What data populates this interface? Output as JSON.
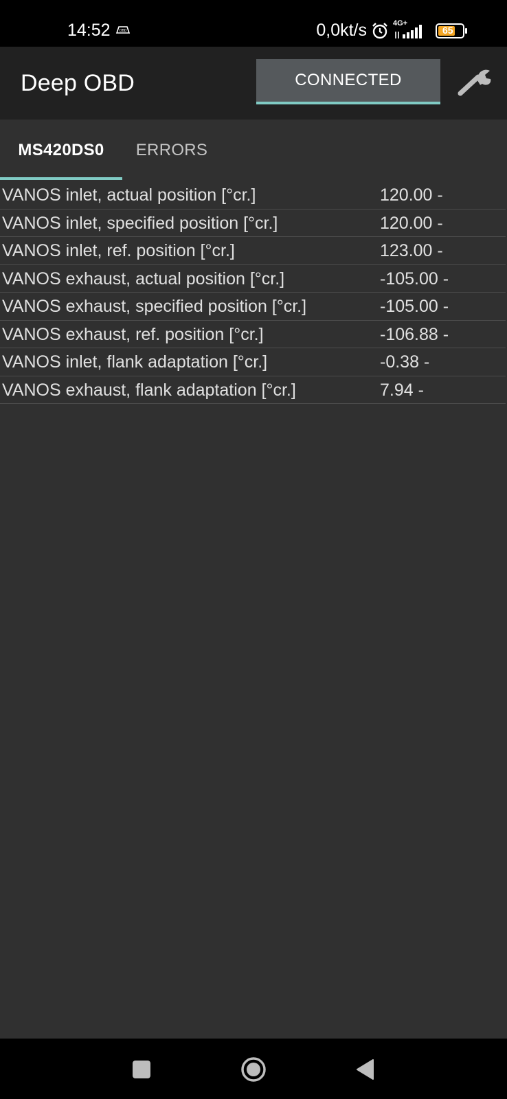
{
  "status_bar": {
    "time": "14:52",
    "obd_badge": "OBD",
    "network_speed": "0,0kt/s",
    "network_type": "4G+",
    "battery_level": "65",
    "icons": [
      "alarm-icon",
      "signal-icon",
      "battery-icon"
    ]
  },
  "app_bar": {
    "title": "Deep OBD",
    "connect_button": "CONNECTED",
    "settings_icon": "wrench-icon"
  },
  "tabs": [
    {
      "label": "MS420DS0",
      "selected": true
    },
    {
      "label": "ERRORS",
      "selected": false
    }
  ],
  "rows": [
    {
      "label": "VANOS inlet, actual position [°cr.]",
      "value": "120.00 -"
    },
    {
      "label": "VANOS inlet, specified position [°cr.]",
      "value": "120.00 -"
    },
    {
      "label": "VANOS inlet, ref. position [°cr.]",
      "value": "123.00 -"
    },
    {
      "label": "VANOS exhaust, actual position [°cr.]",
      "value": "-105.00 -"
    },
    {
      "label": "VANOS exhaust, specified position [°cr.]",
      "value": "-105.00 -"
    },
    {
      "label": "VANOS exhaust, ref. position [°cr.]",
      "value": "-106.88 -"
    },
    {
      "label": "VANOS inlet, flank adaptation [°cr.]",
      "value": "-0.38 -"
    },
    {
      "label": "VANOS exhaust, flank adaptation [°cr.]",
      "value": "7.94 -"
    }
  ],
  "nav_bar": {
    "icons": [
      "recents-icon",
      "home-icon",
      "back-icon"
    ]
  },
  "colors": {
    "background": "#303030",
    "app_bar": "#212121",
    "accent": "#80cbc4",
    "button": "#55595c",
    "battery": "#f5a623"
  }
}
